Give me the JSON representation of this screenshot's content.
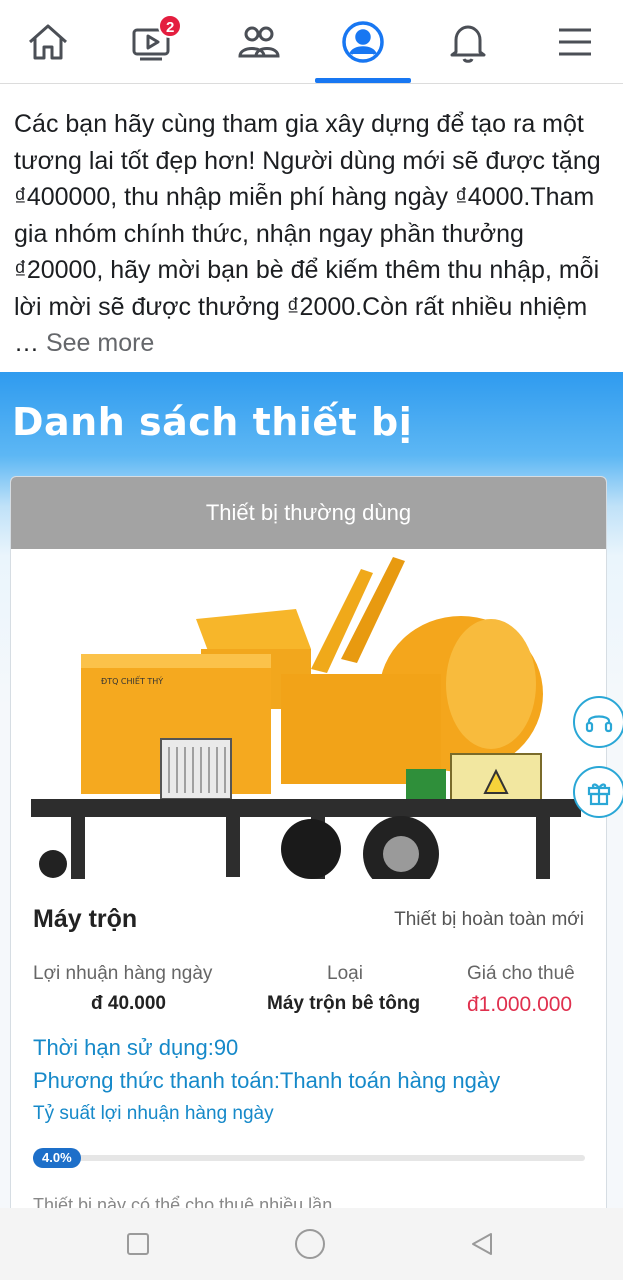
{
  "nav": {
    "items": [
      {
        "name": "home",
        "icon": "home-icon"
      },
      {
        "name": "watch",
        "icon": "video-icon",
        "badge": "2"
      },
      {
        "name": "groups",
        "icon": "friends-icon"
      },
      {
        "name": "profile",
        "icon": "profile-icon",
        "active": true
      },
      {
        "name": "notifications",
        "icon": "bell-icon"
      },
      {
        "name": "menu",
        "icon": "menu-icon"
      }
    ],
    "accent_color": "#1877f2",
    "badge_color": "#e41e3f"
  },
  "post": {
    "text": "Các bạn hãy cùng tham gia xây dựng để tạo ra một tương lai tốt đẹp hơn! Người dùng mới sẽ được tặng ₫400000, thu nhập miễn phí hàng ngày ₫4000.Tham gia nhóm chính thức, nhận ngay phần thưởng ₫20000, hãy mời bạn bè để kiếm thêm thu nhập, mỗi lời mời sẽ được thưởng ₫2000.Còn rất nhiều nhiệm …",
    "see_more": "See more"
  },
  "promo": {
    "title": "Danh sách thiết bị",
    "card_header": "Thiết bị thường dùng",
    "machine_label": "ĐTQ CHIẾT THÝ",
    "product_name": "Máy trộn",
    "product_condition": "Thiết bị hoàn toàn mới",
    "columns": [
      {
        "header": "Lợi nhuận hàng ngày",
        "value": "đ 40.000"
      },
      {
        "header": "Loại",
        "value": "Máy trộn bê tông"
      },
      {
        "header": "Giá cho thuê",
        "value": "đ1.000.000"
      }
    ],
    "term": "Thời hạn sử dụng:90",
    "payment": "Phương thức thanh toán:Thanh toán hàng ngày",
    "rate_label": "Tỷ suất lợi nhuận hàng ngày",
    "progress_label": "4.0%",
    "progress_value": 0.04,
    "cut_text": "Thiết bị này có thể cho thuê nhiều lần",
    "side_buttons": [
      "headset-icon",
      "gift-icon"
    ]
  },
  "system_nav": [
    "recent-apps-icon",
    "home-circle-icon",
    "back-icon"
  ]
}
